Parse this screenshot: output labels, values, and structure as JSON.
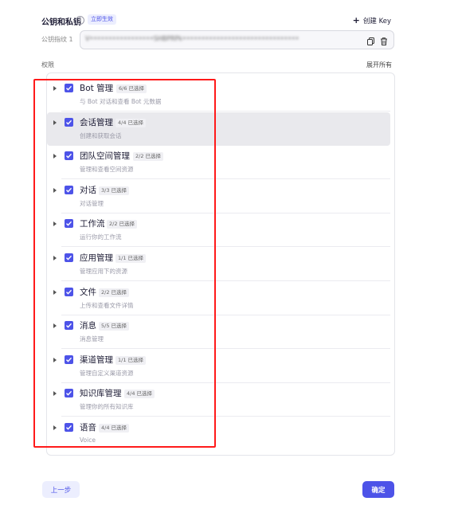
{
  "keys": {
    "title": "公钥和私钥",
    "tag": "立即生效",
    "create_label": "创建 Key",
    "fingerprint_label": "公钥指纹 1",
    "fingerprint_value": "V•••••••••••••••••SHBPRPk•••••••••••••••••••••••••••••••"
  },
  "permissions": {
    "label": "权限",
    "expand_all": "展开所有",
    "items": [
      {
        "name": "Bot 管理",
        "count": "6/6 已选择",
        "desc": "与 Bot 对话和查看 Bot 元数据",
        "checked": true
      },
      {
        "name": "会话管理",
        "count": "4/4 已选择",
        "desc": "创建和获取会话",
        "checked": true
      },
      {
        "name": "团队空间管理",
        "count": "2/2 已选择",
        "desc": "管理和查看空间资源",
        "checked": true
      },
      {
        "name": "对话",
        "count": "3/3 已选择",
        "desc": "对话管理",
        "checked": true
      },
      {
        "name": "工作流",
        "count": "2/2 已选择",
        "desc": "运行你的工作流",
        "checked": true
      },
      {
        "name": "应用管理",
        "count": "1/1 已选择",
        "desc": "管理应用下的资源",
        "checked": true
      },
      {
        "name": "文件",
        "count": "2/2 已选择",
        "desc": "上传和查看文件详情",
        "checked": true
      },
      {
        "name": "消息",
        "count": "5/5 已选择",
        "desc": "消息管理",
        "checked": true
      },
      {
        "name": "渠道管理",
        "count": "1/1 已选择",
        "desc": "管理自定义渠道资源",
        "checked": true
      },
      {
        "name": "知识库管理",
        "count": "4/4 已选择",
        "desc": "管理你的所有知识库",
        "checked": true
      },
      {
        "name": "语音",
        "count": "4/4 已选择",
        "desc": "Voice",
        "checked": true
      }
    ]
  },
  "footer": {
    "back_label": "上一步",
    "confirm_label": "确定"
  },
  "colors": {
    "accent": "#4d53e8",
    "accent_light": "#eceefe",
    "highlight_box": "#ff1a1a",
    "active_row": "#e9e9ed"
  },
  "icons": {
    "info": "info-circle-icon",
    "plus": "plus-icon",
    "copy": "copy-icon",
    "delete": "trash-icon",
    "expand": "caret-right-icon",
    "checkbox": "check-icon"
  }
}
